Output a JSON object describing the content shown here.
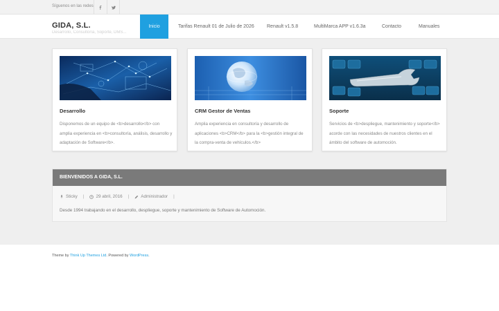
{
  "topbar": {
    "follow_text": "Síguenos en las redes",
    "social": [
      {
        "name": "facebook",
        "icon": "facebook-icon"
      },
      {
        "name": "twitter",
        "icon": "twitter-icon"
      }
    ]
  },
  "header": {
    "site_title": "GIDA, S.L.",
    "site_description": "Desarrollo, Consultoría, Soporte, DMS..."
  },
  "nav": {
    "items": [
      {
        "label": "Inicio",
        "active": true
      },
      {
        "label": "Tarifas Renault 01 de Julio de 2026",
        "active": false
      },
      {
        "label": "Renault v1.5.8",
        "active": false
      },
      {
        "label": "MultiMarca APP v1.6.3a",
        "active": false
      },
      {
        "label": "Contacto",
        "active": false
      },
      {
        "label": "Manuales",
        "active": false
      }
    ]
  },
  "cards": [
    {
      "title": "Desarrollo",
      "text": "Disponemos de un equipo de <b>desarrollo</b> con amplia experiencia en <b>consultoría, análisis, desarrollo y adaptación de Software</b>."
    },
    {
      "title": "CRM Gestor de Ventas",
      "text": "Amplia experiencia en consultoría y desarrollo de aplicaciones <b>CRM</b> para la <b>gestión integral de la compra-venta de vehículos.</b>"
    },
    {
      "title": "Soporte",
      "text": "Servicios de <b>despliegue, mantenimiento y soporte</b> acorde con las necesidades de nuestros clientes en el ámbito del software de automoción."
    }
  ],
  "welcome": {
    "heading": "BIENVENIDOS A GIDA, S.L.",
    "meta": {
      "sticky": "Sticky",
      "date": "29 abril, 2016",
      "author": "Administrador",
      "separator": "|"
    },
    "body": "Desde 1994 trabajando en el desarrollo, despliegue, soporte y mantenimiento de Software de Automoción."
  },
  "footer": {
    "prefix": "Theme by ",
    "theme_link": "Think Up Themes Ltd",
    "middle": ". Powered by ",
    "wp_link": "WordPress",
    "suffix": "."
  },
  "colors": {
    "accent": "#1fa0e0",
    "welcome_header": "#7a7a7a",
    "background": "#efefef"
  }
}
